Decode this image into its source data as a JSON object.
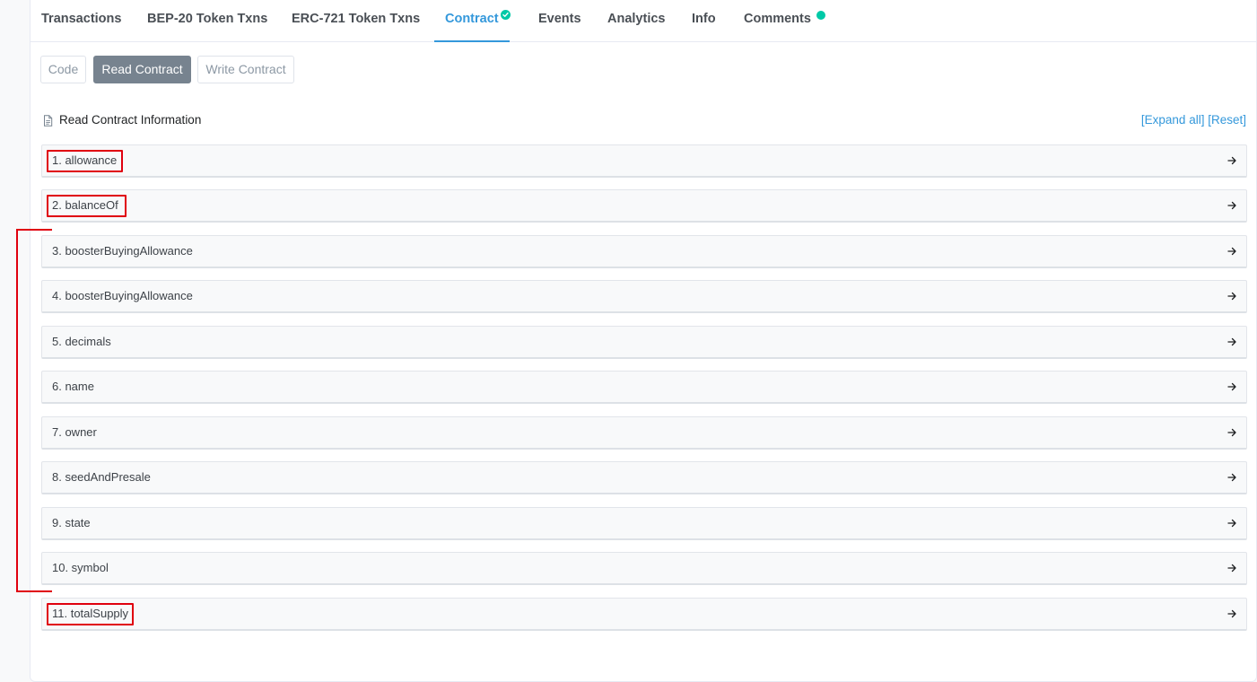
{
  "tabs": [
    {
      "label": "Transactions"
    },
    {
      "label": "BEP-20 Token Txns"
    },
    {
      "label": "ERC-721 Token Txns"
    },
    {
      "label": "Contract"
    },
    {
      "label": "Events"
    },
    {
      "label": "Analytics"
    },
    {
      "label": "Info"
    },
    {
      "label": "Comments"
    }
  ],
  "active_tab": "Contract",
  "sub_buttons": [
    {
      "label": "Code"
    },
    {
      "label": "Read Contract"
    },
    {
      "label": "Write Contract"
    }
  ],
  "active_sub_button": "Read Contract",
  "section": {
    "title": "Read Contract Information",
    "expand_all": "[Expand all]",
    "reset": "[Reset]"
  },
  "functions": [
    {
      "label": "1. allowance"
    },
    {
      "label": "2. balanceOf"
    },
    {
      "label": "3. boosterBuyingAllowance"
    },
    {
      "label": "4. boosterBuyingAllowance"
    },
    {
      "label": "5. decimals"
    },
    {
      "label": "6. name"
    },
    {
      "label": "7. owner"
    },
    {
      "label": "8. seedAndPresale"
    },
    {
      "label": "9. state"
    },
    {
      "label": "10. symbol"
    },
    {
      "label": "11. totalSupply"
    }
  ],
  "icons": {
    "verified": "check-circle-icon",
    "comments_dot": "status-dot-icon",
    "document": "document-icon",
    "row_arrow": "arrow-right-icon"
  },
  "colors": {
    "accent": "#3498db",
    "badge": "#00c9a7",
    "highlight": "#e0000e",
    "active_button": "#77838f"
  }
}
